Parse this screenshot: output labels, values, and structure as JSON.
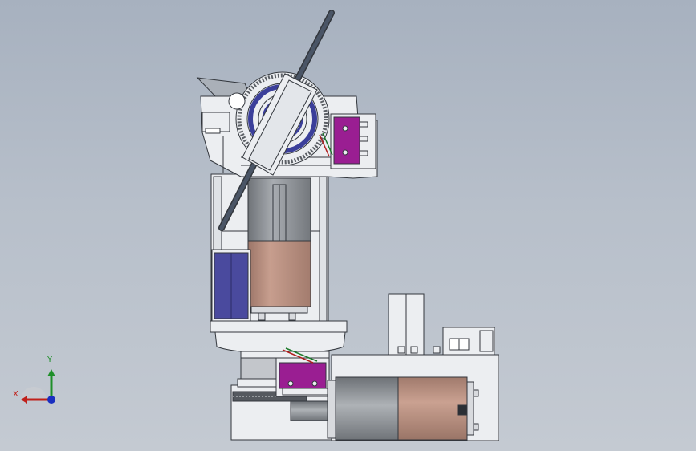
{
  "viewport": {
    "background_top": "#a7b1bf",
    "background_bottom": "#c4cad2"
  },
  "triad": {
    "x_label": "X",
    "y_label": "Y",
    "x_color": "#c0201a",
    "y_color": "#1f8f2a",
    "z_color": "#1a2fc0"
  },
  "model": {
    "part_fill": "#eceef1",
    "edge_color": "#33373d",
    "motor_can_color": "#b88f7f",
    "gearbox_color": "#8d9197",
    "switch_color": "#9a1e92",
    "bearing_color": "#3b3f9a",
    "battery_color": "#4a4a9e",
    "rod_color": "#3a4452"
  }
}
